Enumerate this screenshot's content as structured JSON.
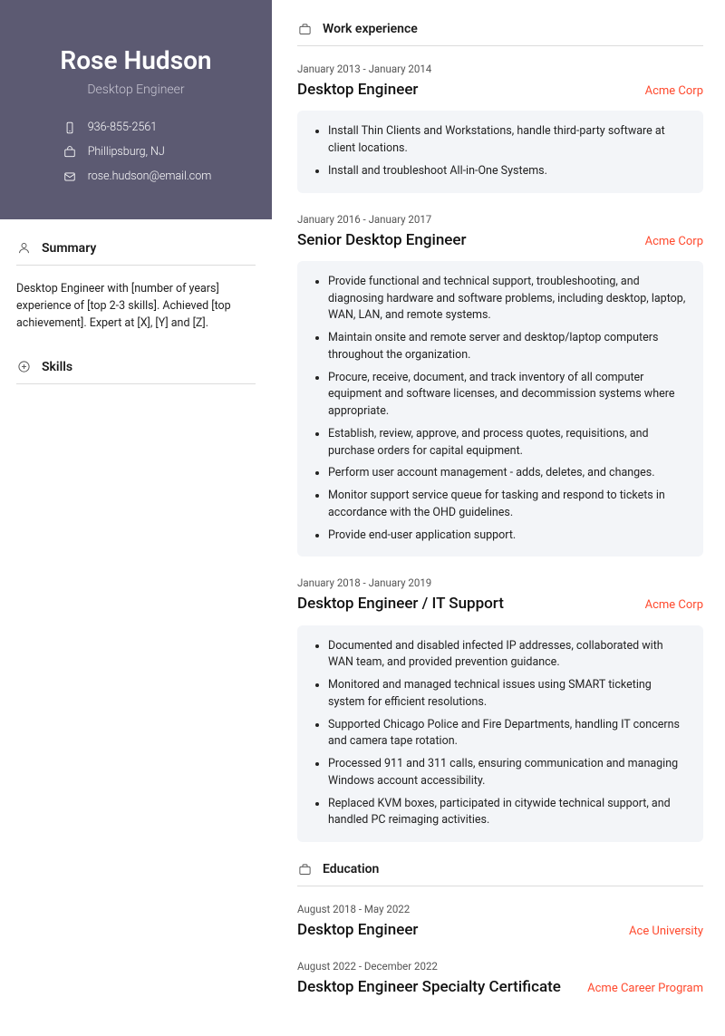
{
  "name": "Rose Hudson",
  "title": "Desktop Engineer",
  "contact": {
    "phone": "936-855-2561",
    "location": "Phillipsburg, NJ",
    "email": "rose.hudson@email.com"
  },
  "sections": {
    "summary_heading": "Summary",
    "skills_heading": "Skills",
    "work_heading": "Work experience",
    "education_heading": "Education"
  },
  "summary": "Desktop Engineer with [number of years] experience of [top 2-3 skills]. Achieved [top achievement]. Expert at [X], [Y] and [Z].",
  "work": [
    {
      "dates": "January 2013 - January 2014",
      "title": "Desktop Engineer",
      "company": "Acme Corp",
      "bullets": [
        "Install Thin Clients and Workstations, handle third-party software at client locations.",
        "Install and troubleshoot All-in-One Systems."
      ]
    },
    {
      "dates": "January 2016 - January 2017",
      "title": "Senior Desktop Engineer",
      "company": "Acme Corp",
      "bullets": [
        "Provide functional and technical support, troubleshooting, and diagnosing hardware and software problems, including desktop, laptop, WAN, LAN, and remote systems.",
        "Maintain onsite and remote server and desktop/laptop computers throughout the organization.",
        "Procure, receive, document, and track inventory of all computer equipment and software licenses, and decommission systems where appropriate.",
        "Establish, review, approve, and process quotes, requisitions, and purchase orders for capital equipment.",
        "Perform user account management - adds, deletes, and changes.",
        "Monitor support service queue for tasking and respond to tickets in accordance with the OHD guidelines.",
        "Provide end-user application support."
      ]
    },
    {
      "dates": "January 2018 - January 2019",
      "title": "Desktop Engineer / IT Support",
      "company": "Acme Corp",
      "bullets": [
        "Documented and disabled infected IP addresses, collaborated with WAN team, and provided prevention guidance.",
        "Monitored and managed technical issues using SMART ticketing system for efficient resolutions.",
        "Supported Chicago Police and Fire Departments, handling IT concerns and camera tape rotation.",
        "Processed 911 and 311 calls, ensuring communication and managing Windows account accessibility.",
        "Replaced KVM boxes, participated in citywide technical support, and handled PC reimaging activities."
      ]
    }
  ],
  "education": [
    {
      "dates": "August 2018 - May 2022",
      "title": "Desktop Engineer",
      "company": "Ace University"
    },
    {
      "dates": "August 2022 - December 2022",
      "title": "Desktop Engineer Specialty Certificate",
      "company": "Acme Career Program"
    }
  ]
}
